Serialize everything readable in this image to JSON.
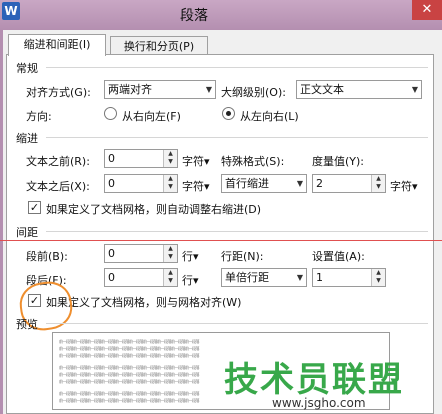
{
  "window": {
    "title": "段落",
    "app_icon": "W",
    "close": "✕"
  },
  "tabs": [
    {
      "label": "缩进和间距(I)",
      "active": true
    },
    {
      "label": "换行和分页(P)",
      "active": false
    }
  ],
  "general": {
    "section": "常规",
    "align_label": "对齐方式(G):",
    "align_value": "两端对齐",
    "outline_label": "大纲级别(O):",
    "outline_value": "正文文本",
    "direction_label": "方向:",
    "rtl_label": "从右向左(F)",
    "ltr_label": "从左向右(L)",
    "direction_selected": "ltr"
  },
  "indent": {
    "section": "缩进",
    "before_label": "文本之前(R):",
    "before_value": "0",
    "before_unit": "字符▾",
    "after_label": "文本之后(X):",
    "after_value": "0",
    "after_unit": "字符▾",
    "special_label": "特殊格式(S):",
    "special_value": "首行缩进",
    "measure_label": "度量值(Y):",
    "measure_value": "2",
    "measure_unit": "字符▾",
    "grid_check_label": "如果定义了文档网格，则自动调整右缩进(D)",
    "grid_checked": true
  },
  "spacing": {
    "section": "间距",
    "before_label": "段前(B):",
    "before_value": "0",
    "before_unit": "行▾",
    "after_label": "段后(F):",
    "after_value": "0",
    "after_unit": "行▾",
    "line_label": "行距(N):",
    "line_value": "单倍行距",
    "setting_label": "设置值(A):",
    "setting_value": "1",
    "grid_check_label": "如果定义了文档网格，则与网格对齐(W)",
    "grid_checked": true
  },
  "preview": {
    "section": "预览",
    "sample_text": "前一段落前一段落前一段落前一段落前一段落前一段落前一段落前一段落前一段落前一段落"
  },
  "watermark": {
    "text": "技术员联盟",
    "url": "www.jsgho.com"
  },
  "colors": {
    "annotation_line": "#e05050",
    "annotation_circle": "#ef8f2f",
    "watermark": "#38a84a"
  }
}
